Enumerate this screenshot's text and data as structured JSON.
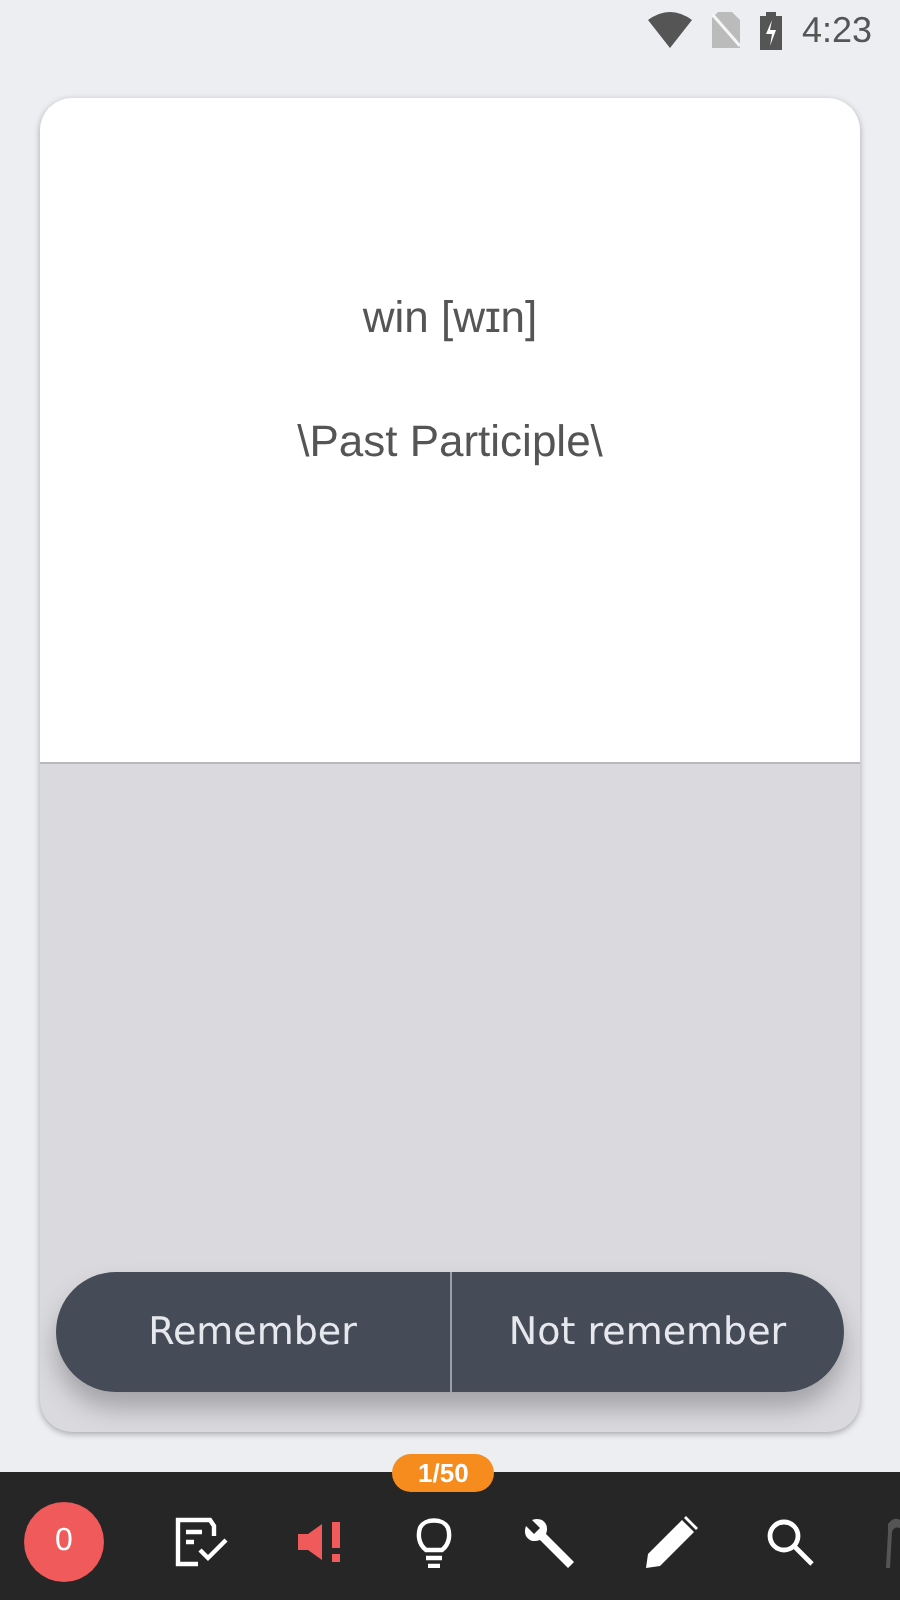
{
  "status_bar": {
    "time": "4:23"
  },
  "card": {
    "word": "win [wɪn]",
    "form": "\\Past Participle\\"
  },
  "answer_buttons": [
    "Remember",
    "Not remember"
  ],
  "progress": "1/50",
  "toolbar": {
    "score": "0",
    "tools": [
      {
        "kind": "checklist",
        "alert": false
      },
      {
        "kind": "speaker",
        "alert": true
      },
      {
        "kind": "bulb",
        "alert": false
      },
      {
        "kind": "wrench",
        "alert": false
      },
      {
        "kind": "pencil",
        "alert": false
      },
      {
        "kind": "search",
        "alert": false
      },
      {
        "kind": "partial",
        "alert": false
      }
    ]
  }
}
